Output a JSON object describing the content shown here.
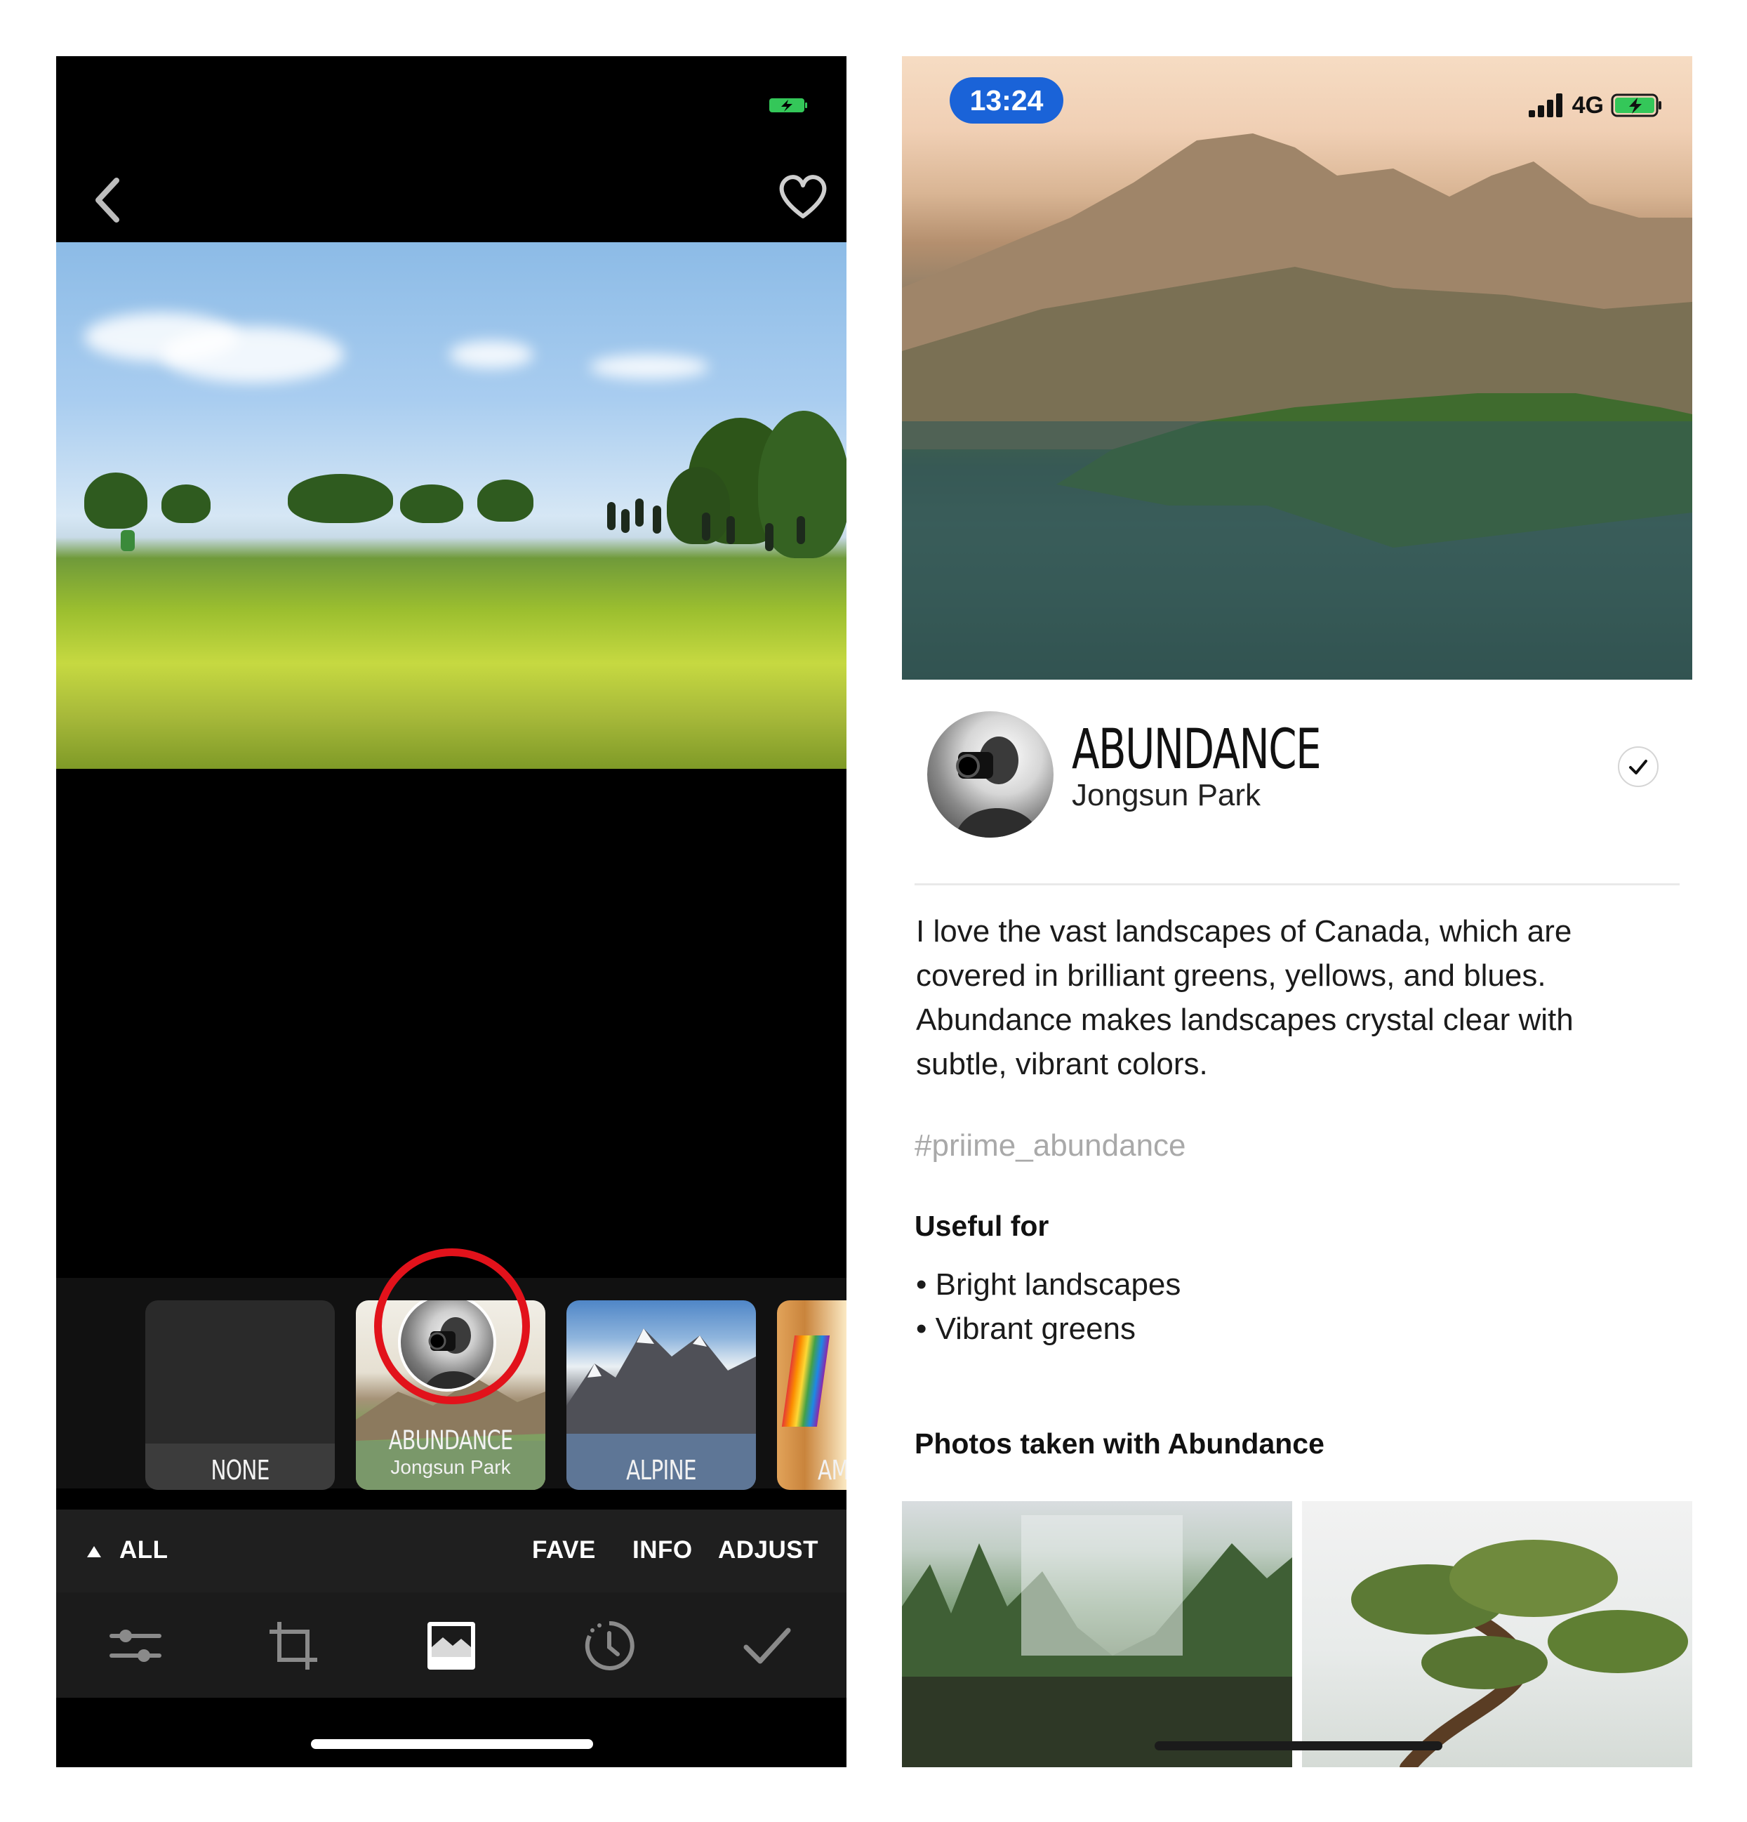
{
  "left_screen": {
    "filters": [
      {
        "name": "NONE"
      },
      {
        "name": "ABUNDANCE",
        "artist": "Jongsun Park"
      },
      {
        "name": "ALPINE"
      },
      {
        "name": "AM"
      }
    ],
    "tabs": {
      "all": "ALL",
      "fave": "FAVE",
      "info": "INFO",
      "adjust": "ADJUST"
    },
    "toolbar_icons": [
      "sliders-icon",
      "crop-icon",
      "filters-icon",
      "history-icon",
      "checkmark-icon"
    ],
    "colors": {
      "highlight_ring": "#e2121b",
      "battery": "#34c759"
    }
  },
  "right_screen": {
    "status": {
      "time": "13:24",
      "network": "4G"
    },
    "filter": {
      "name": "ABUNDANCE",
      "artist": "Jongsun Park"
    },
    "description": "I love the vast landscapes of Canada, which are covered in brilliant greens, yellows, and blues. Abundance makes landscapes crystal clear with subtle, vibrant colors.",
    "hashtag": "#priime_abundance",
    "useful_for": {
      "title": "Useful for",
      "items": [
        "• Bright landscapes",
        "• Vibrant greens"
      ]
    },
    "photos_section": {
      "title": "Photos taken with Abundance"
    },
    "colors": {
      "time_pill": "#1a63d8"
    }
  }
}
